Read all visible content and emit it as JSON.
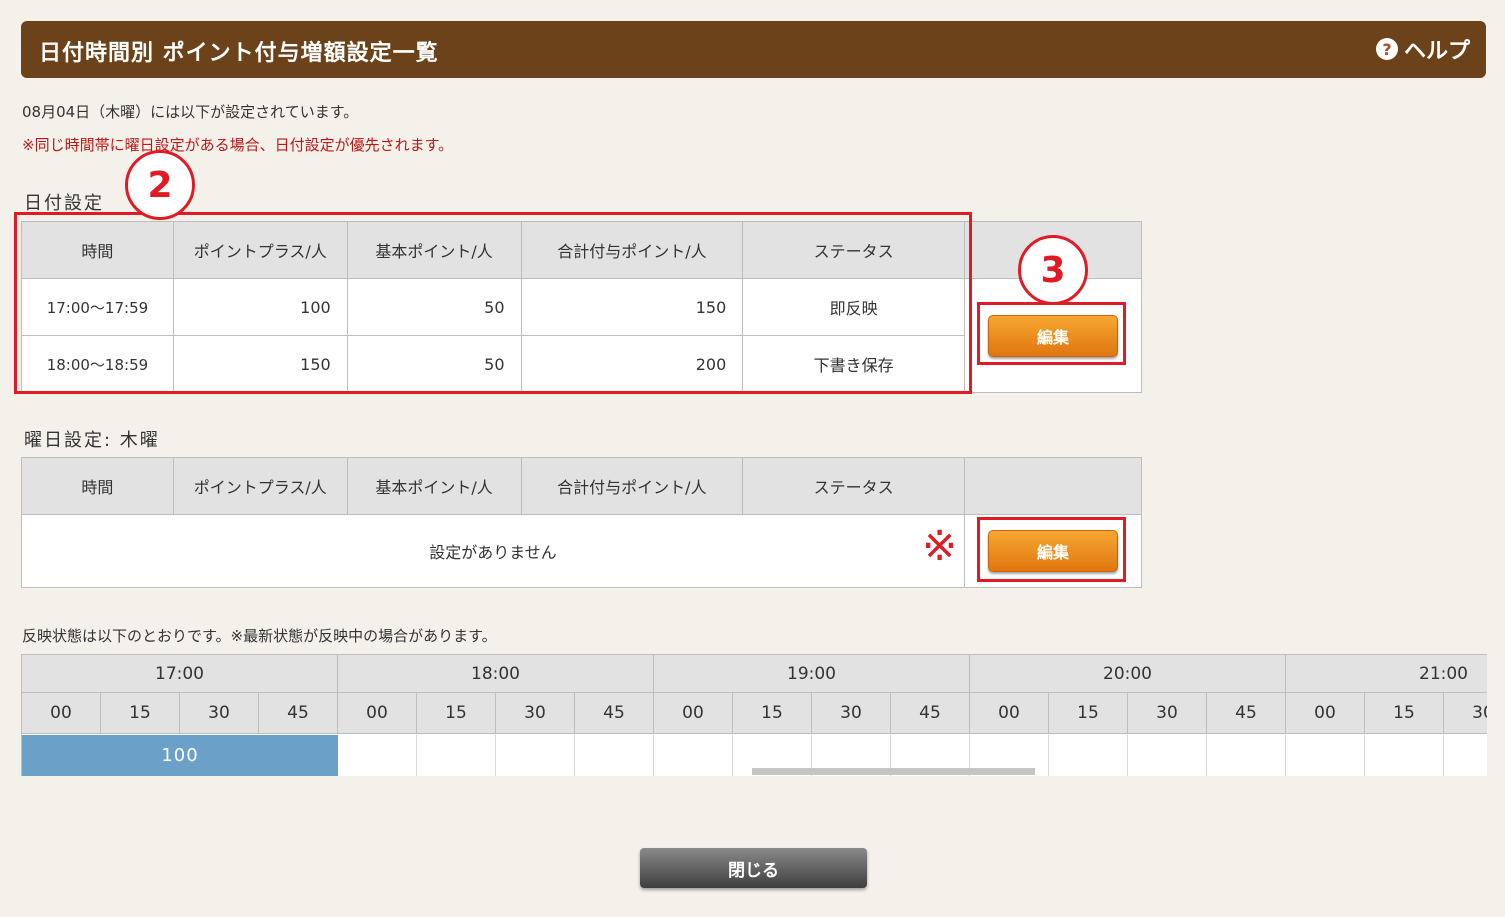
{
  "header": {
    "title": "日付時間別 ポイント付与増額設定一覧",
    "help_label": "ヘルプ",
    "help_icon": "question-circle-icon"
  },
  "info_text": "08月04日（木曜）には以下が設定されています。",
  "notice_text": "※同じ時間帯に曜日設定がある場合、日付設定が優先されます。",
  "date_section": {
    "label": "日付設定",
    "columns": [
      "時間",
      "ポイントプラス/人",
      "基本ポイント/人",
      "合計付与ポイント/人",
      "ステータス"
    ],
    "rows": [
      {
        "time": "17:00〜17:59",
        "plus": "100",
        "base": "50",
        "total": "150",
        "status": "即反映"
      },
      {
        "time": "18:00〜18:59",
        "plus": "150",
        "base": "50",
        "total": "200",
        "status": "下書き保存"
      }
    ],
    "edit_label": "編集"
  },
  "weekday_section": {
    "label": "曜日設定: 木曜",
    "columns": [
      "時間",
      "ポイントプラス/人",
      "基本ポイント/人",
      "合計付与ポイント/人",
      "ステータス"
    ],
    "empty_text": "設定がありません",
    "edit_label": "編集",
    "mark": "※"
  },
  "annotations": {
    "circle2": "2",
    "circle3": "3",
    "color": "#e01b24"
  },
  "status_caption": "反映状態は以下のとおりです。※最新状態が反映中の場合があります。",
  "timeline": {
    "hours": [
      "17:00",
      "18:00",
      "19:00",
      "20:00",
      "21:00"
    ],
    "minutes": [
      "00",
      "15",
      "30",
      "45"
    ],
    "blocks": [
      {
        "value": "100",
        "hour": "17:00",
        "color": "#6ba1c9"
      }
    ]
  },
  "close_label": "閉じる"
}
